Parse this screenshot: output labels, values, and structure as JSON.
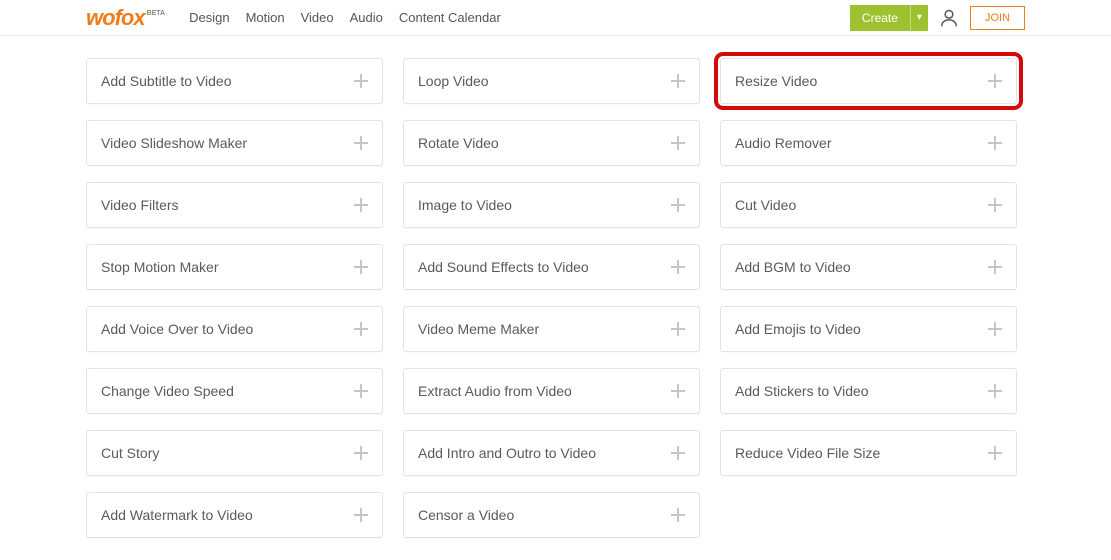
{
  "logo": {
    "part1": "wo",
    "part2": "fox",
    "beta": "BETA"
  },
  "nav": {
    "design": "Design",
    "motion": "Motion",
    "video": "Video",
    "audio": "Audio",
    "calendar": "Content Calendar"
  },
  "header": {
    "create": "Create",
    "join": "JOIN"
  },
  "tools": {
    "c1r1": "Add Subtitle to Video",
    "c2r1": "Loop Video",
    "c3r1": "Resize Video",
    "c1r2": "Video Slideshow Maker",
    "c2r2": "Rotate Video",
    "c3r2": "Audio Remover",
    "c1r3": "Video Filters",
    "c2r3": "Image to Video",
    "c3r3": "Cut Video",
    "c1r4": "Stop Motion Maker",
    "c2r4": "Add Sound Effects to Video",
    "c3r4": "Add BGM to Video",
    "c1r5": "Add Voice Over to Video",
    "c2r5": "Video Meme Maker",
    "c3r5": "Add Emojis to Video",
    "c1r6": "Change Video Speed",
    "c2r6": "Extract Audio from Video",
    "c3r6": "Add Stickers to Video",
    "c1r7": "Cut Story",
    "c2r7": "Add Intro and Outro to Video",
    "c3r7": "Reduce Video File Size",
    "c1r8": "Add Watermark to Video",
    "c2r8": "Censor a Video"
  }
}
